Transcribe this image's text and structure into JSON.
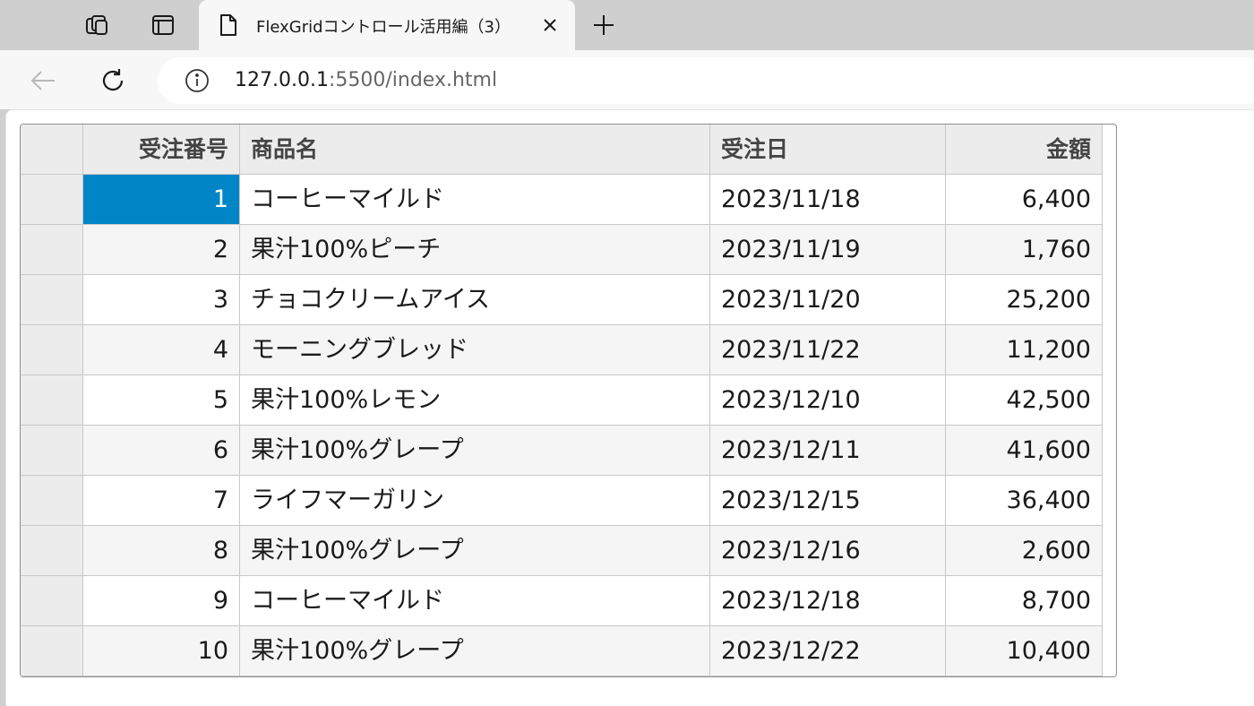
{
  "browser": {
    "tab": {
      "title": "FlexGridコントロール活用編（3）"
    },
    "address": {
      "host": "127.0.0.1",
      "rest": ":5500/index.html"
    }
  },
  "grid": {
    "columns": [
      "受注番号",
      "商品名",
      "受注日",
      "金額"
    ],
    "rows": [
      {
        "id": "1",
        "product": "コーヒーマイルド",
        "date": "2023/11/18",
        "amount": "6,400"
      },
      {
        "id": "2",
        "product": "果汁100%ピーチ",
        "date": "2023/11/19",
        "amount": "1,760"
      },
      {
        "id": "3",
        "product": "チョコクリームアイス",
        "date": "2023/11/20",
        "amount": "25,200"
      },
      {
        "id": "4",
        "product": "モーニングブレッド",
        "date": "2023/11/22",
        "amount": "11,200"
      },
      {
        "id": "5",
        "product": "果汁100%レモン",
        "date": "2023/12/10",
        "amount": "42,500"
      },
      {
        "id": "6",
        "product": "果汁100%グレープ",
        "date": "2023/12/11",
        "amount": "41,600"
      },
      {
        "id": "7",
        "product": "ライフマーガリン",
        "date": "2023/12/15",
        "amount": "36,400"
      },
      {
        "id": "8",
        "product": "果汁100%グレープ",
        "date": "2023/12/16",
        "amount": "2,600"
      },
      {
        "id": "9",
        "product": "コーヒーマイルド",
        "date": "2023/12/18",
        "amount": "8,700"
      },
      {
        "id": "10",
        "product": "果汁100%グレープ",
        "date": "2023/12/22",
        "amount": "10,400"
      }
    ]
  },
  "colors": {
    "selection": "#0085c7",
    "chrome": "#cfcfcf",
    "toolbar": "#f7f7f7"
  }
}
